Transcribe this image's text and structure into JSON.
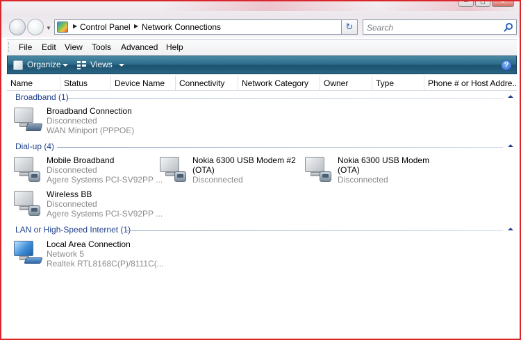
{
  "window": {
    "controls": [
      "─",
      "▢",
      "✕"
    ]
  },
  "address": {
    "breadcrumbs": [
      "Control Panel",
      "Network Connections"
    ]
  },
  "search": {
    "placeholder": "Search"
  },
  "menu": {
    "items": [
      "File",
      "Edit",
      "View",
      "Tools",
      "Advanced",
      "Help"
    ]
  },
  "commandbar": {
    "organize_label": "Organize",
    "views_label": "Views",
    "help_label": "?"
  },
  "columns": [
    "Name",
    "Status",
    "Device Name",
    "Connectivity",
    "Network Category",
    "Owner",
    "Type",
    "Phone # or Host Addre..."
  ],
  "groups": [
    {
      "title": "Broadband (1)",
      "items": [
        {
          "name": "Broadband Connection",
          "status": "Disconnected",
          "device": "WAN Miniport (PPPOE)",
          "icon": "broadband-modem"
        }
      ]
    },
    {
      "title": "Dial-up (4)",
      "items": [
        {
          "name": "Mobile Broadband",
          "status": "Disconnected",
          "device": "Agere Systems PCI-SV92PP ...",
          "icon": "dialup-phone"
        },
        {
          "name": "Nokia 6300 USB Modem #2",
          "name2": "(OTA)",
          "status": "Disconnected",
          "icon": "dialup-phone"
        },
        {
          "name": "Nokia 6300 USB Modem",
          "name2": "(OTA)",
          "status": "Disconnected",
          "icon": "dialup-phone"
        },
        {
          "name": "Wireless BB",
          "status": "Disconnected",
          "device": "Agere Systems PCI-SV92PP ...",
          "icon": "dialup-phone"
        }
      ]
    },
    {
      "title": "LAN or High-Speed Internet (1)",
      "items": [
        {
          "name": "Local Area Connection",
          "status": "Network  5",
          "device": "Realtek RTL8168C(P)/8111C(...",
          "icon": "lan-adapter"
        }
      ]
    }
  ],
  "colors": {
    "border": "#d9262b",
    "group_title": "#1e3f8a",
    "commandbar": "#2d6c8a",
    "secondary_text": "#8a8a8a"
  }
}
